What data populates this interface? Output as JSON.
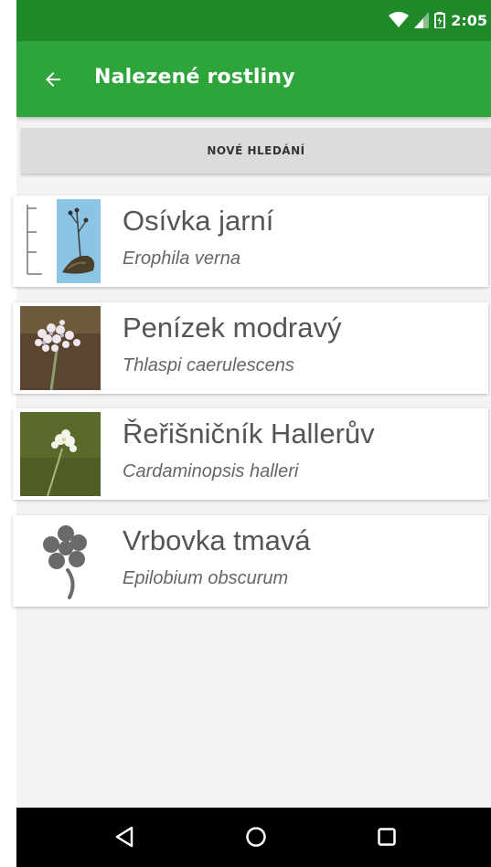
{
  "status_bar": {
    "time": "2:05",
    "icons": [
      "wifi-icon",
      "signal-icon",
      "battery-icon"
    ]
  },
  "app_bar": {
    "title": "Nalezené rostliny",
    "back_icon": "arrow-left-icon"
  },
  "new_search_label": "NOVÉ HLEDÁNÍ",
  "results": [
    {
      "common": "Osívka jarní",
      "latin": "Erophila verna",
      "thumb": "plant-drawing"
    },
    {
      "common": "Penízek modravý",
      "latin": "Thlaspi caerulescens",
      "thumb": "plant-photo"
    },
    {
      "common": "Řeřišničník Hallerův",
      "latin": "Cardaminopsis halleri",
      "thumb": "plant-photo"
    },
    {
      "common": "Vrbovka tmavá",
      "latin": "Epilobium obscurum",
      "thumb": "flower-placeholder-icon"
    }
  ],
  "nav_bar": {
    "icons": [
      "back-triangle-icon",
      "home-circle-icon",
      "recents-square-icon"
    ]
  },
  "colors": {
    "status_bar": "#1f8a2a",
    "app_bar": "#2ea53a",
    "nav_bar": "#000000",
    "card_bg": "#ffffff",
    "button_bg": "#dcdcdc"
  }
}
